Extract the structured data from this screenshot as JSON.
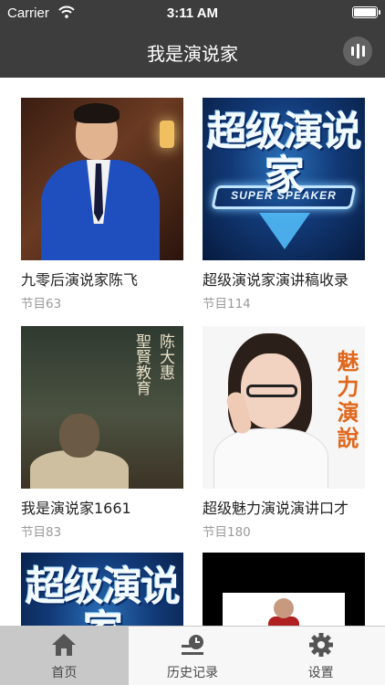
{
  "status_bar": {
    "carrier": "Carrier",
    "time": "3:11 AM"
  },
  "nav": {
    "title": "我是演说家",
    "menu_icon": "bars-icon"
  },
  "cards": [
    {
      "title": "九零后演说家陈飞",
      "count": "节目63"
    },
    {
      "title": "超级演说家演讲稿收录",
      "count": "节目114",
      "logo_text": "超级演说家",
      "logo_sub": "SUPER SPEAKER"
    },
    {
      "title": "我是演说家1661",
      "count": "节目83",
      "cover_text_1": "聖賢教育",
      "cover_text_2": "陈大惠"
    },
    {
      "title": "超级魅力演说演讲口才",
      "count": "节目180",
      "cover_text": "魅力演說"
    },
    {
      "title": "",
      "count": "",
      "logo_text": "超级演说家"
    },
    {
      "title": "",
      "count": ""
    }
  ],
  "tabbar": {
    "items": [
      {
        "label": "首页",
        "icon": "home-icon",
        "active": true
      },
      {
        "label": "历史记录",
        "icon": "history-icon",
        "active": false
      },
      {
        "label": "设置",
        "icon": "gear-icon",
        "active": false
      }
    ]
  }
}
